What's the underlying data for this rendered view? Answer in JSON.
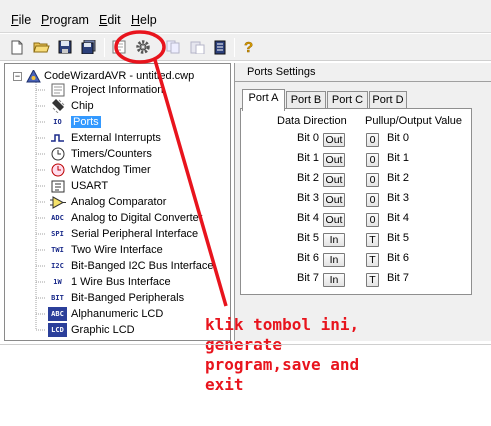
{
  "menubar": {
    "items": [
      {
        "label": "File",
        "underline": "F",
        "rest": "ile"
      },
      {
        "label": "Program",
        "underline": "P",
        "rest": "rogram"
      },
      {
        "label": "Edit",
        "underline": "E",
        "rest": "dit"
      },
      {
        "label": "Help",
        "underline": "H",
        "rest": "elp"
      }
    ]
  },
  "toolbar": {
    "buttons": [
      "new-file-icon",
      "open-folder-icon",
      "save-icon",
      "save-all-icon",
      "preview-icon",
      "generate-gear-icon",
      "copy-icon",
      "paste-icon",
      "document-icon",
      "help-icon"
    ]
  },
  "tree": {
    "root_label": "CodeWizardAVR - untitled.cwp",
    "items": [
      {
        "label": "Project Information",
        "icon": "information-icon"
      },
      {
        "label": "Chip",
        "icon": "chip-icon"
      },
      {
        "label": "Ports",
        "icon": "io-ports-icon",
        "selected": true
      },
      {
        "label": "External Interrupts",
        "icon": "interrupt-icon"
      },
      {
        "label": "Timers/Counters",
        "icon": "clock-icon"
      },
      {
        "label": "Watchdog Timer",
        "icon": "watchdog-icon"
      },
      {
        "label": "USART",
        "icon": "usart-icon"
      },
      {
        "label": "Analog Comparator",
        "icon": "comparator-icon"
      },
      {
        "label": "Analog to Digital Converter",
        "icon": "adc-icon"
      },
      {
        "label": "Serial Peripheral Interface",
        "icon": "spi-icon"
      },
      {
        "label": "Two Wire Interface",
        "icon": "twi-icon"
      },
      {
        "label": "Bit-Banged I2C Bus Interface",
        "icon": "i2c-icon"
      },
      {
        "label": "1 Wire Bus Interface",
        "icon": "one-wire-icon"
      },
      {
        "label": "Bit-Banged Peripherals",
        "icon": "bit-icon"
      },
      {
        "label": "Alphanumeric LCD",
        "icon": "alpha-lcd-icon"
      },
      {
        "label": "Graphic LCD",
        "icon": "graphic-lcd-icon"
      }
    ],
    "icon_text": {
      "io": "IO",
      "adc": "ADC",
      "spi": "SPI",
      "twi": "TWI",
      "i2c": "I2C",
      "one_wire": "1W",
      "bit": "BIT",
      "abc": "ABC",
      "lcd": "LCD"
    }
  },
  "panel": {
    "title": "Ports Settings",
    "tabs": [
      "Port A",
      "Port B",
      "Port C",
      "Port D"
    ],
    "active_tab": "Port A",
    "data_direction_header": "Data Direction",
    "pullup_header": "Pullup/Output Value",
    "bits": [
      {
        "label": "Bit 0",
        "direction": "Out",
        "value": "0",
        "value_label": "Bit 0"
      },
      {
        "label": "Bit 1",
        "direction": "Out",
        "value": "0",
        "value_label": "Bit 1"
      },
      {
        "label": "Bit 2",
        "direction": "Out",
        "value": "0",
        "value_label": "Bit 2"
      },
      {
        "label": "Bit 3",
        "direction": "Out",
        "value": "0",
        "value_label": "Bit 3"
      },
      {
        "label": "Bit 4",
        "direction": "Out",
        "value": "0",
        "value_label": "Bit 4"
      },
      {
        "label": "Bit 5",
        "direction": "In",
        "value": "T",
        "value_label": "Bit 5"
      },
      {
        "label": "Bit 6",
        "direction": "In",
        "value": "T",
        "value_label": "Bit 6"
      },
      {
        "label": "Bit 7",
        "direction": "In",
        "value": "T",
        "value_label": "Bit 7"
      }
    ]
  },
  "annotation": {
    "lines": [
      "klik tombol ini,",
      "generate",
      "program,save and",
      "exit"
    ],
    "color": "#e8141d"
  },
  "colors": {
    "selection": "#3399ff",
    "annotation_red": "#e8141d"
  }
}
